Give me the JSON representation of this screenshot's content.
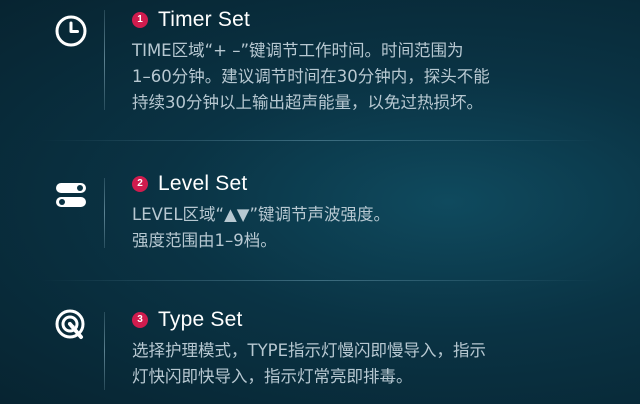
{
  "sections": [
    {
      "badge": "1",
      "title": "Timer Set",
      "icon": "clock-icon",
      "lines": [
        "TIME区域“+ –”键调节工作时间。时间范围为",
        "1–60分钟。建议调节时间在30分钟内，探头不能",
        "持续30分钟以上输出超声能量，以免过热损坏。"
      ]
    },
    {
      "badge": "2",
      "title": "Level Set",
      "icon": "toggle-switches-icon",
      "lines": [
        "LEVEL区域“▲▼”键调节声波强度。",
        "强度范围由1–9档。"
      ]
    },
    {
      "badge": "3",
      "title": "Type Set",
      "icon": "touch-target-icon",
      "lines": [
        "选择护理模式，TYPE指示灯慢闪即慢导入，指示",
        "灯快闪即快导入，指示灯常亮即排毒。"
      ]
    }
  ],
  "colors": {
    "accent": "#d01c4e",
    "text": "#b7c8d1",
    "background": "#0a3344"
  }
}
